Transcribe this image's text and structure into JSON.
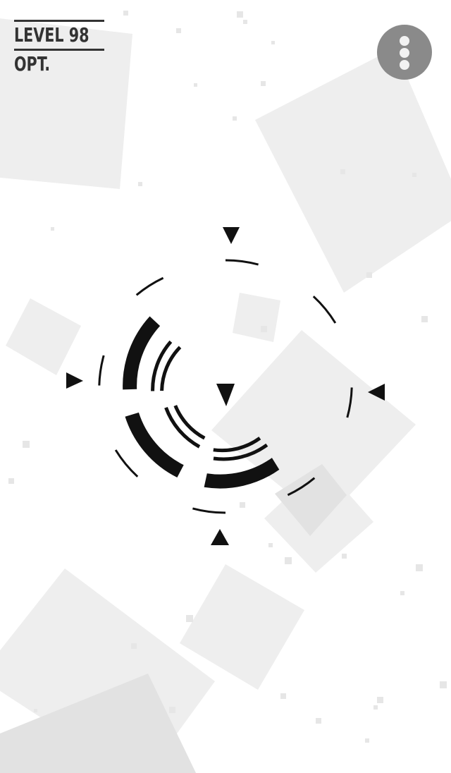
{
  "hud": {
    "level_label": "LEVEL 98",
    "sub_label": "OPT."
  },
  "menu": {
    "icon": "more-vertical-icon"
  },
  "colors": {
    "background": "#ffffff",
    "square_light": "#eeeeee",
    "square_mid": "#e2e2e2",
    "ink": "#111111",
    "hud_text": "#333333",
    "menu_bg": "#8a8a8a",
    "menu_dots": "#f2f2f2"
  },
  "puzzle": {
    "indicators": [
      "triangle-up-pointer",
      "triangle-down-pointer",
      "triangle-left-pointer",
      "triangle-right-pointer",
      "center-pointer"
    ],
    "rings": [
      "outer-dashed-ring",
      "thick-arc-ring",
      "double-arc-ring"
    ]
  }
}
